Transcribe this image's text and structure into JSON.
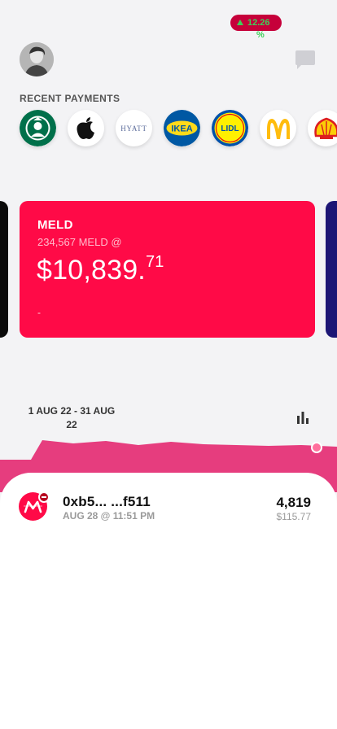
{
  "header": {
    "avatar_icon": "user-photo",
    "chat_icon": "chat-bubble-icon"
  },
  "recent_payments": {
    "label": "RECENT PAYMENTS",
    "merchants": [
      {
        "name": "Starbucks",
        "icon": "starbucks-logo"
      },
      {
        "name": "Apple",
        "icon": "apple-logo"
      },
      {
        "name": "Hyatt",
        "icon": "hyatt-logo",
        "text": "HYATT"
      },
      {
        "name": "IKEA",
        "icon": "ikea-logo",
        "text": "IKEA"
      },
      {
        "name": "Lidl",
        "icon": "lidl-logo",
        "text": "LIDL"
      },
      {
        "name": "McDonald's",
        "icon": "mcdonalds-logo"
      },
      {
        "name": "Shell",
        "icon": "shell-logo"
      }
    ]
  },
  "card": {
    "name": "MELD",
    "subtitle": "234,567 MELD @",
    "amount_main": "$10,839.",
    "amount_cents": "71",
    "change_value": "12.26",
    "change_unit": "%",
    "footer": "-",
    "colors": {
      "background": "#ff0a47",
      "change_positive": "#3ecf5a"
    }
  },
  "range": {
    "label_line1": "1 AUG 22 - 31 AUG",
    "label_line2": "22",
    "chart_toggle_icon": "bar-chart-icon"
  },
  "transactions": [
    {
      "address": "0xb5... ...f511",
      "time": "AUG 28 @ 11:51 PM",
      "amount": "4,819",
      "fiat": "$115.77",
      "icon": "meld-token-icon",
      "badge_icon": "minus-badge-icon"
    }
  ]
}
